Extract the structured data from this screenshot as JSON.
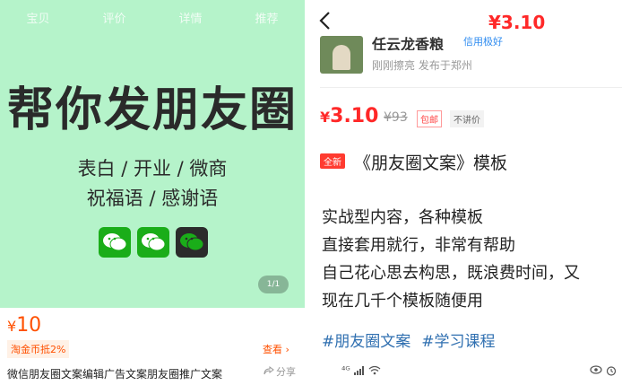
{
  "left": {
    "tabs": [
      "宝贝",
      "评价",
      "详情",
      "推荐"
    ],
    "banner": {
      "headline": "帮你发朋友圈",
      "line1": "表白 / 开业 / 微商",
      "line2": "祝福语 / 感谢语",
      "icons": [
        "wechat-icon",
        "wechat-icon",
        "wechat-dark-icon"
      ],
      "pager": "1/1",
      "bg_color": "#b5f3ca"
    },
    "price_currency": "¥",
    "price_value": "10",
    "coin_badge": "淘金币抵2%",
    "view_link": "查看",
    "item_title": "微信朋友圈文案编辑广告文案朋友圈推广文案",
    "share_label": "分享"
  },
  "right": {
    "top_price": "¥3.10",
    "seller": {
      "name": "任云龙香粮",
      "verified": "信用极好",
      "posted": "刚刚擦亮 发布于郑州"
    },
    "price_currency": "¥",
    "price_value": "3.10",
    "orig_price": "¥93",
    "tag_ship": "包邮",
    "tag_nobargain": "不讲价",
    "new_badge": "全新",
    "product_title": "《朋友圈文案》模板",
    "desc": [
      "实战型内容，各种模板",
      "直接套用就行，非常有帮助",
      "自己花心思去构思，既浪费时间，又",
      "现在几千个模板随便用"
    ],
    "hashtags": [
      "#朋友圈文案",
      "#学习课程"
    ],
    "status": {
      "signal": "⁴ᴳ",
      "right_icons": [
        "eye-icon",
        "alarm-icon"
      ]
    },
    "accent": "#ff2828"
  }
}
